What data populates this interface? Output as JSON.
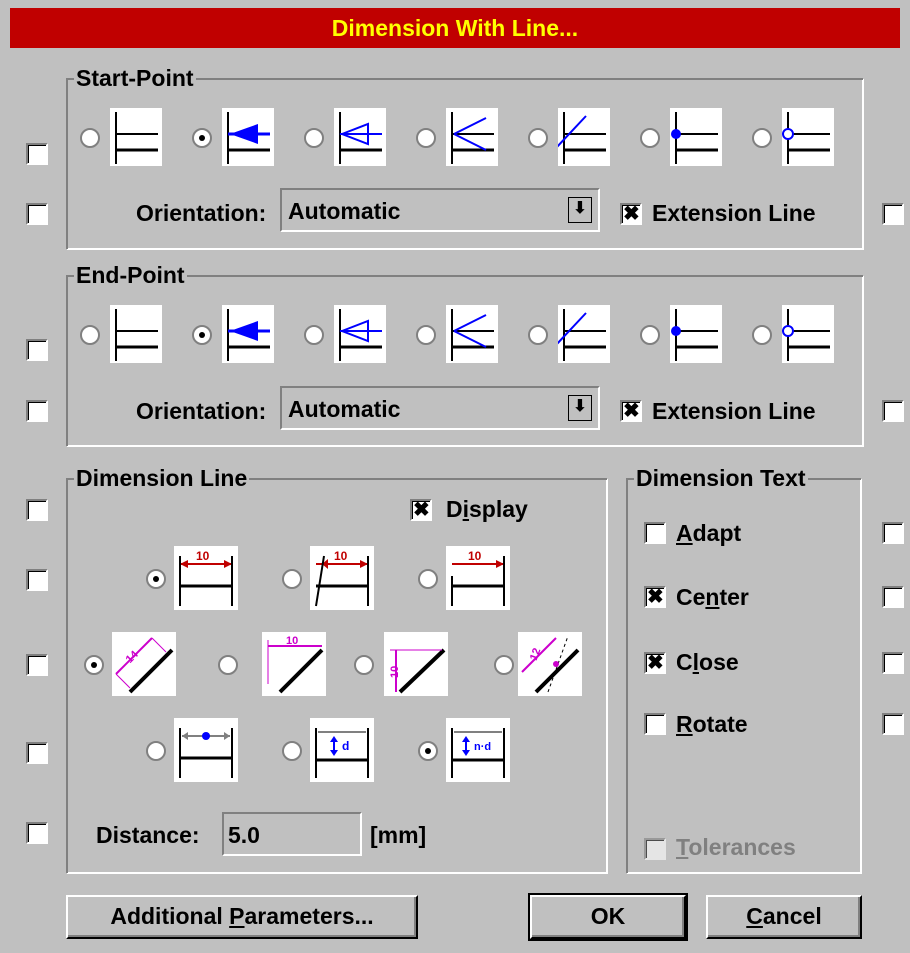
{
  "window": {
    "title": "Dimension With Line..."
  },
  "start_point": {
    "legend": "Start-Point",
    "orientation_label": "Orientation:",
    "orientation_value": "Automatic",
    "extension_label": "Extension Line",
    "extension_checked": true,
    "selected_style": 1
  },
  "end_point": {
    "legend": "End-Point",
    "orientation_label": "Orientation:",
    "orientation_value": "Automatic",
    "extension_label": "Extension Line",
    "extension_checked": true,
    "selected_style": 1
  },
  "dimension_line": {
    "legend": "Dimension Line",
    "display_label": "Display",
    "display_underline": "i",
    "display_checked": true,
    "sample_value": "10",
    "d_label": "d",
    "nd_label": "n·d",
    "distance_label": "Distance:",
    "distance_value": "5.0",
    "distance_unit": "[mm]"
  },
  "dimension_text": {
    "legend": "Dimension Text",
    "adapt": {
      "label": "Adapt",
      "checked": false
    },
    "center": {
      "label": "Center",
      "checked": true
    },
    "close": {
      "label": "Close",
      "checked": true
    },
    "rotate": {
      "label": "Rotate",
      "checked": false
    },
    "tolerances": {
      "label": "Tolerances",
      "checked": false,
      "enabled": false
    }
  },
  "buttons": {
    "additional": "Additional Parameters...",
    "ok": "OK",
    "cancel": "Cancel"
  },
  "colors": {
    "title_bg": "#c00000",
    "title_fg": "#ffff00",
    "arrow_blue": "#0000ff",
    "dim_red": "#c00000",
    "dim_magenta": "#cc00cc"
  }
}
